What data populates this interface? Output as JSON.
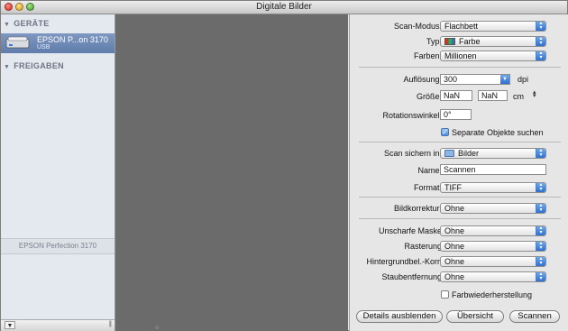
{
  "window": {
    "title": "Digitale Bilder"
  },
  "sidebar": {
    "devices_header": "GERÄTE",
    "shared_header": "FREIGABEN",
    "device": {
      "name": "EPSON P...on 3170",
      "connection": "USB"
    },
    "selected_device_label": "EPSON Perfection 3170"
  },
  "settings": {
    "scan_mode": {
      "label": "Scan-Modus:",
      "value": "Flachbett"
    },
    "type": {
      "label": "Typ:",
      "value": "Farbe"
    },
    "colors": {
      "label": "Farben:",
      "value": "Millionen"
    },
    "resolution": {
      "label": "Auflösung:",
      "value": "300",
      "unit": "dpi"
    },
    "size": {
      "label": "Größe:",
      "width": "NaN",
      "height": "NaN",
      "unit": "cm"
    },
    "rotation": {
      "label": "Rotationswinkel:",
      "value": "0°"
    },
    "detect_separate": {
      "label": "Separate Objekte suchen",
      "checked": true
    },
    "save_in": {
      "label": "Scan sichern in:",
      "value": "Bilder"
    },
    "name": {
      "label": "Name:",
      "value": "Scannen"
    },
    "format": {
      "label": "Format:",
      "value": "TIFF"
    },
    "image_correction": {
      "label": "Bildkorrektur:",
      "value": "Ohne"
    },
    "unsharp_mask": {
      "label": "Unscharfe Maske",
      "value": "Ohne"
    },
    "descreening": {
      "label": "Rasterung",
      "value": "Ohne"
    },
    "background_correction": {
      "label": "Hintergrundbel.-Korr.",
      "value": "Ohne"
    },
    "dust_removal": {
      "label": "Staubentfernung",
      "value": "Ohne"
    },
    "color_restoration": {
      "label": "Farbwiederherstellung",
      "checked": false
    }
  },
  "buttons": {
    "hide_details": "Details ausblenden",
    "overview": "Übersicht",
    "scan": "Scannen"
  }
}
